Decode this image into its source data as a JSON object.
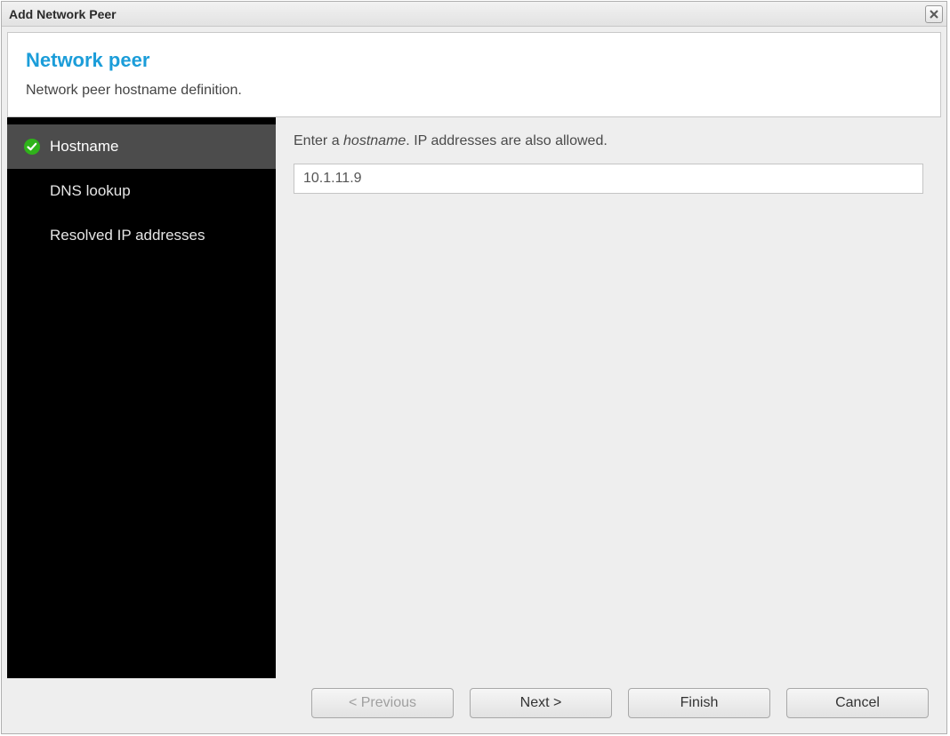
{
  "window": {
    "title": "Add Network Peer"
  },
  "header": {
    "title": "Network peer",
    "subtitle": "Network peer hostname definition."
  },
  "sidebar": {
    "items": [
      {
        "label": "Hostname",
        "active": true,
        "status": "ok"
      },
      {
        "label": "DNS lookup",
        "active": false,
        "status": "none"
      },
      {
        "label": "Resolved IP addresses",
        "active": false,
        "status": "none"
      }
    ]
  },
  "content": {
    "instruction_prefix": "Enter a ",
    "instruction_em": "hostname",
    "instruction_suffix": ". IP addresses are also allowed.",
    "hostname_value": "10.1.11.9"
  },
  "footer": {
    "previous": "< Previous",
    "next": "Next >",
    "finish": "Finish",
    "cancel": "Cancel"
  }
}
